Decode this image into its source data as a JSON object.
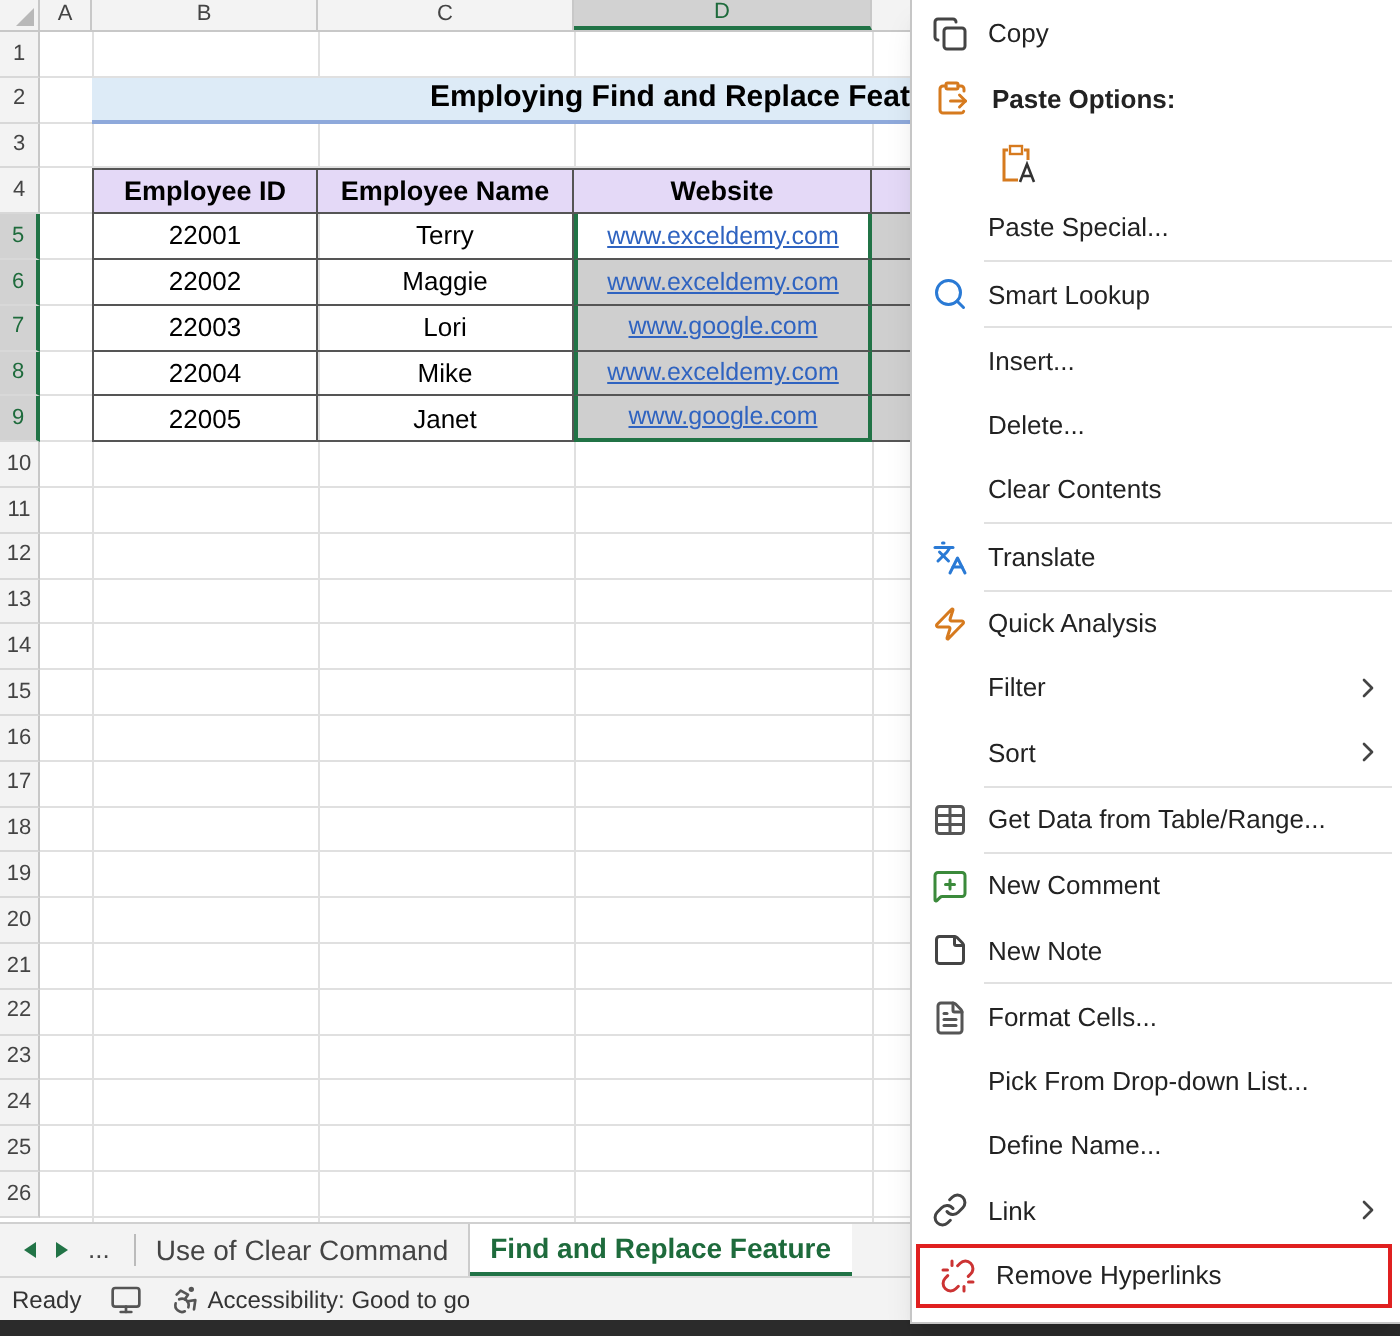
{
  "columns": [
    {
      "label": "A",
      "selected": false
    },
    {
      "label": "B",
      "selected": false
    },
    {
      "label": "C",
      "selected": false
    },
    {
      "label": "D",
      "selected": true
    }
  ],
  "row_numbers": [
    {
      "label": "1",
      "selected": false
    },
    {
      "label": "2",
      "selected": false
    },
    {
      "label": "3",
      "selected": false
    },
    {
      "label": "4",
      "selected": false
    },
    {
      "label": "5",
      "selected": true
    },
    {
      "label": "6",
      "selected": true
    },
    {
      "label": "7",
      "selected": true
    },
    {
      "label": "8",
      "selected": true
    },
    {
      "label": "9",
      "selected": true
    },
    {
      "label": "10",
      "selected": false
    },
    {
      "label": "11",
      "selected": false
    },
    {
      "label": "12",
      "selected": false
    },
    {
      "label": "13",
      "selected": false
    },
    {
      "label": "14",
      "selected": false
    },
    {
      "label": "15",
      "selected": false
    },
    {
      "label": "16",
      "selected": false
    },
    {
      "label": "17",
      "selected": false
    },
    {
      "label": "18",
      "selected": false
    },
    {
      "label": "19",
      "selected": false
    },
    {
      "label": "20",
      "selected": false
    },
    {
      "label": "21",
      "selected": false
    },
    {
      "label": "22",
      "selected": false
    },
    {
      "label": "23",
      "selected": false
    },
    {
      "label": "24",
      "selected": false
    },
    {
      "label": "25",
      "selected": false
    },
    {
      "label": "26",
      "selected": false
    }
  ],
  "title": "Employing Find and Replace Feat",
  "table": {
    "headers": [
      "Employee ID",
      "Employee Name",
      "Website"
    ],
    "rows": [
      {
        "id": "22001",
        "name": "Terry",
        "website": "www.exceldemy.com",
        "selected": false
      },
      {
        "id": "22002",
        "name": "Maggie",
        "website": "www.exceldemy.com",
        "selected": true
      },
      {
        "id": "22003",
        "name": "Lori",
        "website": "www.google.com",
        "selected": true
      },
      {
        "id": "22004",
        "name": "Mike",
        "website": "www.exceldemy.com",
        "selected": true
      },
      {
        "id": "22005",
        "name": "Janet",
        "website": "www.google.com",
        "selected": true
      }
    ]
  },
  "context_menu": {
    "items": [
      {
        "kind": "command",
        "label": "Copy",
        "submenu": false,
        "highlighted": false
      },
      {
        "kind": "heading",
        "label": "Paste Options:"
      },
      {
        "kind": "paste_option"
      },
      {
        "kind": "command",
        "label": "Paste Special...",
        "submenu": false,
        "highlighted": false
      },
      {
        "kind": "separator"
      },
      {
        "kind": "command",
        "label": "Smart Lookup",
        "submenu": false,
        "highlighted": false
      },
      {
        "kind": "separator"
      },
      {
        "kind": "command",
        "label": "Insert...",
        "submenu": false,
        "highlighted": false
      },
      {
        "kind": "command",
        "label": "Delete...",
        "submenu": false,
        "highlighted": false
      },
      {
        "kind": "command",
        "label": "Clear Contents",
        "submenu": false,
        "highlighted": false
      },
      {
        "kind": "separator"
      },
      {
        "kind": "command",
        "label": "Translate",
        "submenu": false,
        "highlighted": false
      },
      {
        "kind": "separator"
      },
      {
        "kind": "command",
        "label": "Quick Analysis",
        "submenu": false,
        "highlighted": false
      },
      {
        "kind": "command",
        "label": "Filter",
        "submenu": true,
        "highlighted": false
      },
      {
        "kind": "command",
        "label": "Sort",
        "submenu": true,
        "highlighted": false
      },
      {
        "kind": "separator"
      },
      {
        "kind": "command",
        "label": "Get Data from Table/Range...",
        "submenu": false,
        "highlighted": false
      },
      {
        "kind": "separator"
      },
      {
        "kind": "command",
        "label": "New Comment",
        "submenu": false,
        "highlighted": false
      },
      {
        "kind": "command",
        "label": "New Note",
        "submenu": false,
        "highlighted": false
      },
      {
        "kind": "separator"
      },
      {
        "kind": "command",
        "label": "Format Cells...",
        "submenu": false,
        "highlighted": false
      },
      {
        "kind": "command",
        "label": "Pick From Drop-down List...",
        "submenu": false,
        "highlighted": false
      },
      {
        "kind": "command",
        "label": "Define Name...",
        "submenu": false,
        "highlighted": false
      },
      {
        "kind": "command",
        "label": "Link",
        "submenu": true,
        "highlighted": false
      },
      {
        "kind": "command",
        "label": "Remove Hyperlinks",
        "submenu": false,
        "highlighted": true
      }
    ]
  },
  "sheet_tabs": {
    "more": "...",
    "tabs": [
      {
        "label": "Use of Clear Command",
        "selected": false
      },
      {
        "label": "Find and Replace Feature",
        "selected": true
      }
    ]
  },
  "status_bar": {
    "mode": "Ready",
    "accessibility": "Accessibility: Good to go"
  }
}
